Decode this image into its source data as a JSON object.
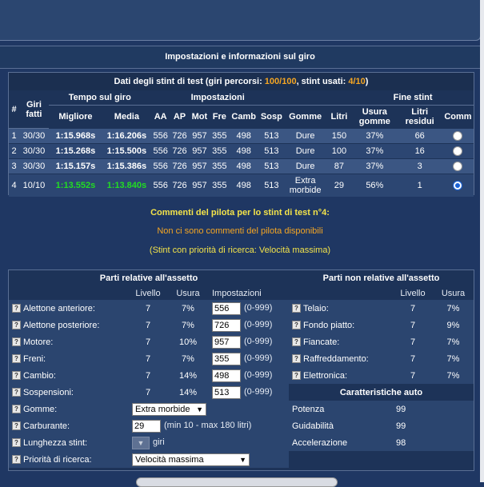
{
  "section_title": "Impostazioni e informazioni sul giro",
  "stint": {
    "title_prefix": "Dati degli stint di test (giri percorsi: ",
    "laps_done": "100/100",
    "title_mid": ", stint usati: ",
    "stints_used": "4/10",
    "title_suffix": ")",
    "headers": {
      "num": "#",
      "laps": "Giri fatti",
      "lap_time": "Tempo sul giro",
      "settings": "Impostazioni",
      "end_stint": "Fine stint",
      "best": "Migliore",
      "avg": "Media",
      "aa": "AA",
      "ap": "AP",
      "mot": "Mot",
      "fre": "Fre",
      "camb": "Camb",
      "sosp": "Sosp",
      "tyres": "Gomme",
      "fuel": "Litri",
      "wear": "Usura gomme",
      "fuel_left": "Litri residui",
      "comm": "Comm"
    },
    "rows": [
      {
        "num": "1",
        "laps": "30/30",
        "best": "1:15.968s",
        "avg": "1:16.206s",
        "aa": "556",
        "ap": "726",
        "mot": "957",
        "fre": "355",
        "camb": "498",
        "sosp": "513",
        "tyres": "Dure",
        "fuel": "150",
        "wear": "37%",
        "left": "66",
        "selected": false
      },
      {
        "num": "2",
        "laps": "30/30",
        "best": "1:15.268s",
        "avg": "1:15.500s",
        "aa": "556",
        "ap": "726",
        "mot": "957",
        "fre": "355",
        "camb": "498",
        "sosp": "513",
        "tyres": "Dure",
        "fuel": "100",
        "wear": "37%",
        "left": "16",
        "selected": false
      },
      {
        "num": "3",
        "laps": "30/30",
        "best": "1:15.157s",
        "avg": "1:15.386s",
        "aa": "556",
        "ap": "726",
        "mot": "957",
        "fre": "355",
        "camb": "498",
        "sosp": "513",
        "tyres": "Dure",
        "fuel": "87",
        "wear": "37%",
        "left": "3",
        "selected": false
      },
      {
        "num": "4",
        "laps": "10/10",
        "best": "1:13.552s",
        "avg": "1:13.840s",
        "aa": "556",
        "ap": "726",
        "mot": "957",
        "fre": "355",
        "camb": "498",
        "sosp": "513",
        "tyres": "Extra morbide",
        "fuel": "29",
        "wear": "56%",
        "left": "1",
        "selected": true
      }
    ],
    "highlight_color": "#22dd22"
  },
  "comments": {
    "title": "Commenti del pilota per lo stint di test n°4:",
    "text": "Non ci sono commenti del pilota disponibili",
    "priority": "(Stint con priorità di ricerca: Velocità massima)"
  },
  "setup": {
    "left_title": "Parti relative all'assetto",
    "right_title": "Parti non relative all'assetto",
    "col_level": "Livello",
    "col_wear": "Usura",
    "col_settings": "Impostazioni",
    "parts": [
      {
        "label": "Alettone anteriore:",
        "level": "7",
        "wear": "7%",
        "value": "556",
        "range": "(0-999)"
      },
      {
        "label": "Alettone posteriore:",
        "level": "7",
        "wear": "7%",
        "value": "726",
        "range": "(0-999)"
      },
      {
        "label": "Motore:",
        "level": "7",
        "wear": "10%",
        "value": "957",
        "range": "(0-999)"
      },
      {
        "label": "Freni:",
        "level": "7",
        "wear": "7%",
        "value": "355",
        "range": "(0-999)"
      },
      {
        "label": "Cambio:",
        "level": "7",
        "wear": "14%",
        "value": "498",
        "range": "(0-999)"
      },
      {
        "label": "Sospensioni:",
        "level": "7",
        "wear": "14%",
        "value": "513",
        "range": "(0-999)"
      }
    ],
    "other_parts": [
      {
        "label": "Telaio:",
        "level": "7",
        "wear": "7%"
      },
      {
        "label": "Fondo piatto:",
        "level": "7",
        "wear": "9%"
      },
      {
        "label": "Fiancate:",
        "level": "7",
        "wear": "7%"
      },
      {
        "label": "Raffreddamento:",
        "level": "7",
        "wear": "7%"
      },
      {
        "label": "Elettronica:",
        "level": "7",
        "wear": "7%"
      }
    ],
    "car_title": "Caratteristiche auto",
    "car": [
      {
        "label": "Potenza",
        "value": "99"
      },
      {
        "label": "Guidabilità",
        "value": "99"
      },
      {
        "label": "Accelerazione",
        "value": "98"
      }
    ],
    "tyres_label": "Gomme:",
    "tyres_value": "Extra morbide",
    "fuel_label": "Carburante:",
    "fuel_value": "29",
    "fuel_range": "(min 10 - max 180 litri)",
    "length_label": "Lunghezza stint:",
    "length_unit": "giri",
    "priority_label": "Priorità di ricerca:",
    "priority_value": "Velocità massima",
    "help_icon_glyph": "?"
  }
}
